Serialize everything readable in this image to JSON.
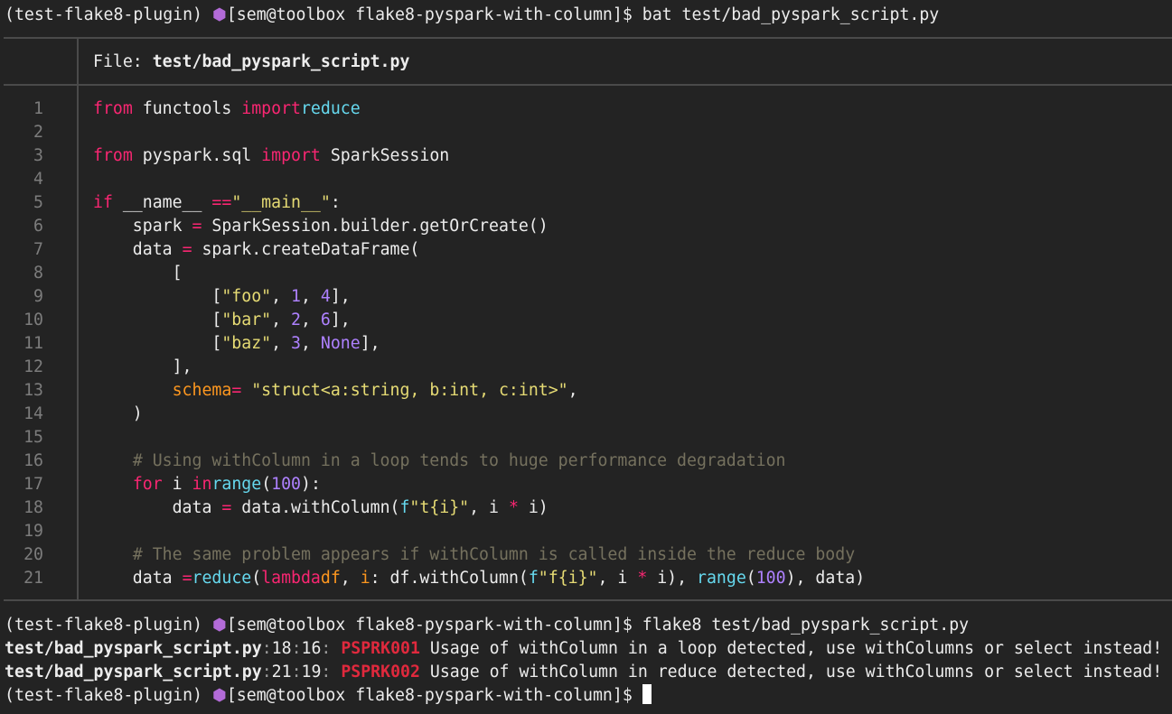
{
  "terminal": {
    "prompt_env": "(test-flake8-plugin)",
    "prompt_icon": "⬢",
    "prompt_path": "[sem@toolbox flake8-pyspark-with-column]$",
    "commands": [
      "bat test/bad_pyspark_script.py",
      "flake8 test/bad_pyspark_script.py",
      ""
    ]
  },
  "bat": {
    "file_label": "File:",
    "file_name": "test/bad_pyspark_script.py",
    "line_numbers": [
      "1",
      "2",
      "3",
      "4",
      "5",
      "6",
      "7",
      "8",
      "9",
      "10",
      "11",
      "12",
      "13",
      "14",
      "15",
      "16",
      "17",
      "18",
      "19",
      "20",
      "21"
    ]
  },
  "code_lines": [
    [
      [
        "kw",
        "from"
      ],
      [
        "",
        "functools "
      ],
      [
        "kw",
        "import"
      ],
      [
        "",
        ""
      ],
      [
        "fn",
        "reduce"
      ]
    ],
    [],
    [
      [
        "kw",
        "from"
      ],
      [
        "",
        "pyspark.sql "
      ],
      [
        "kw",
        "import"
      ],
      [
        "",
        "SparkSession"
      ]
    ],
    [],
    [
      [
        "kw",
        "if"
      ],
      [
        "",
        "__name__ "
      ],
      [
        "op",
        "=="
      ],
      [
        "",
        ""
      ],
      [
        "str",
        "\"__main__\""
      ],
      [
        "",
        ":"
      ]
    ],
    [
      [
        "",
        "    spark "
      ],
      [
        "op",
        "="
      ],
      [
        "",
        "SparkSession.builder.getOrCreate()"
      ]
    ],
    [
      [
        "",
        "    data "
      ],
      [
        "op",
        "="
      ],
      [
        "",
        "spark.createDataFrame("
      ]
    ],
    [
      [
        "",
        "        ["
      ]
    ],
    [
      [
        "",
        "            ["
      ],
      [
        "str",
        "\"foo\""
      ],
      [
        "",
        ", "
      ],
      [
        "num",
        "1"
      ],
      [
        "",
        ", "
      ],
      [
        "num",
        "4"
      ],
      [
        "",
        "],"
      ]
    ],
    [
      [
        "",
        "            ["
      ],
      [
        "str",
        "\"bar\""
      ],
      [
        "",
        ", "
      ],
      [
        "num",
        "2"
      ],
      [
        "",
        ", "
      ],
      [
        "num",
        "6"
      ],
      [
        "",
        "],"
      ]
    ],
    [
      [
        "",
        "            ["
      ],
      [
        "str",
        "\"baz\""
      ],
      [
        "",
        ", "
      ],
      [
        "num",
        "3"
      ],
      [
        "",
        ", "
      ],
      [
        "num",
        "None"
      ],
      [
        "",
        "],"
      ]
    ],
    [
      [
        "",
        "        ],"
      ]
    ],
    [
      [
        "",
        "        "
      ],
      [
        "par",
        "schema"
      ],
      [
        "op",
        "="
      ],
      [
        "str",
        "\"struct<a:string, b:int, c:int>\""
      ],
      [
        "",
        ","
      ]
    ],
    [
      [
        "",
        "    )"
      ]
    ],
    [],
    [
      [
        "",
        "    "
      ],
      [
        "cm",
        "# Using withColumn in a loop tends to huge performance degradation"
      ]
    ],
    [
      [
        "",
        "    "
      ],
      [
        "kw",
        "for"
      ],
      [
        "",
        " i "
      ],
      [
        "kw",
        "in"
      ],
      [
        "",
        ""
      ],
      [
        "fn",
        "range"
      ],
      [
        "",
        "("
      ],
      [
        "num",
        "100"
      ],
      [
        "",
        "):"
      ]
    ],
    [
      [
        "",
        "        data "
      ],
      [
        "op",
        "="
      ],
      [
        "",
        "data.withColumn("
      ],
      [
        "fn",
        "f"
      ],
      [
        "str",
        "\"t{i}\""
      ],
      [
        "",
        ", i "
      ],
      [
        "op",
        "*"
      ],
      [
        "",
        " i)"
      ]
    ],
    [],
    [
      [
        "",
        "    "
      ],
      [
        "cm",
        "# The same problem appears if withColumn is called inside the reduce body"
      ]
    ],
    [
      [
        "",
        "    data "
      ],
      [
        "op",
        "="
      ],
      [
        "",
        ""
      ],
      [
        "fn",
        "reduce"
      ],
      [
        "",
        "("
      ],
      [
        "kw",
        "lambda"
      ],
      [
        "",
        ""
      ],
      [
        "par",
        "df"
      ],
      [
        "",
        ", "
      ],
      [
        "par",
        "i"
      ],
      [
        "",
        ": df.withColumn("
      ],
      [
        "fn",
        "f"
      ],
      [
        "str",
        "\"f{i}\""
      ],
      [
        "",
        ", i "
      ],
      [
        "op",
        "*"
      ],
      [
        "",
        " i), "
      ],
      [
        "fn",
        "range"
      ],
      [
        "",
        "("
      ],
      [
        "num",
        "100"
      ],
      [
        "",
        "), data)"
      ]
    ]
  ],
  "flake8_results": [
    {
      "file": "test/bad_pyspark_script.py",
      "line": "18",
      "col": "16",
      "code": "PSPRK001",
      "message": "Usage of withColumn in a loop detected, use withColumns or select instead!"
    },
    {
      "file": "test/bad_pyspark_script.py",
      "line": "21",
      "col": "19",
      "code": "PSPRK002",
      "message": "Usage of withColumn in reduce detected, use withColumns or select instead!"
    }
  ],
  "colors": {
    "background": "#232323",
    "keyword": "#f92672",
    "builtin": "#66d9ef",
    "string": "#e6db74",
    "number": "#ae81ff",
    "parameter": "#fd971f",
    "comment": "#75715e",
    "error_code": "#e0293d",
    "prompt_icon": "#b36bd8"
  }
}
